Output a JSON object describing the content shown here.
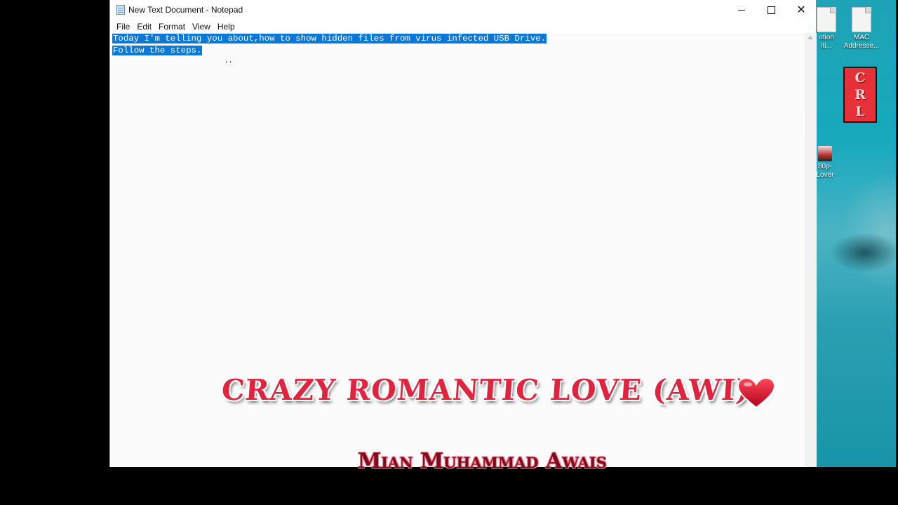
{
  "window": {
    "title": "New Text Document - Notepad",
    "controls": {
      "minimize": "—",
      "maximize": "□",
      "close": "✕"
    }
  },
  "menu": {
    "items": [
      "File",
      "Edit",
      "Format",
      "View",
      "Help"
    ]
  },
  "editor": {
    "lines": [
      "Today I'm telling you about,how to show hidden files from virus infected USB Drive.",
      "Follow the steps."
    ],
    "selection_color": "#0a78d7"
  },
  "desktop": {
    "icons": [
      {
        "label_line1": "otion",
        "label_line2": "iti...",
        "icon": "shortcut-icon"
      },
      {
        "label_line1": "MAC",
        "label_line2": "Addresse...",
        "icon": "text-document-icon"
      },
      {
        "label_line1": "80p-",
        "label_line2": "Lover",
        "icon": "video-file-icon"
      }
    ],
    "badge_letters": [
      "C",
      "R",
      "L"
    ],
    "badge_color": "#e8303a"
  },
  "overlay": {
    "channel_title": "CRAZY ROMANTIC LOVE (AWI)",
    "author_name": "Mian Muhammad Awais",
    "heart_color": "#e0142b"
  }
}
